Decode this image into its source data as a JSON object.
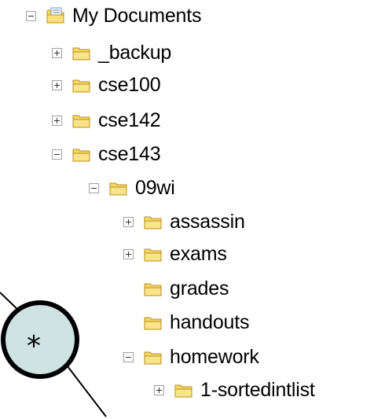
{
  "tree": {
    "nodes": [
      {
        "label": "My Documents",
        "toggle": "minus",
        "icon": "my-documents-icon"
      },
      {
        "label": "_backup",
        "toggle": "plus",
        "icon": "folder-icon"
      },
      {
        "label": "cse100",
        "toggle": "plus",
        "icon": "folder-icon"
      },
      {
        "label": "cse142",
        "toggle": "plus",
        "icon": "folder-icon"
      },
      {
        "label": "cse143",
        "toggle": "minus",
        "icon": "folder-icon"
      },
      {
        "label": "09wi",
        "toggle": "minus",
        "icon": "folder-icon"
      },
      {
        "label": "assassin",
        "toggle": "plus",
        "icon": "folder-icon"
      },
      {
        "label": "exams",
        "toggle": "plus",
        "icon": "folder-icon"
      },
      {
        "label": "grades",
        "toggle": "none",
        "icon": "folder-icon"
      },
      {
        "label": "handouts",
        "toggle": "none",
        "icon": "folder-icon"
      },
      {
        "label": "homework",
        "toggle": "minus",
        "icon": "folder-icon"
      },
      {
        "label": "1-sortedintlist",
        "toggle": "plus",
        "icon": "folder-icon"
      }
    ]
  },
  "overlay": {
    "node_symbol": "*",
    "node_fill": "#cfe3e3"
  },
  "colors": {
    "folder_fill": "#f6d86a",
    "folder_stroke": "#b8901a"
  }
}
